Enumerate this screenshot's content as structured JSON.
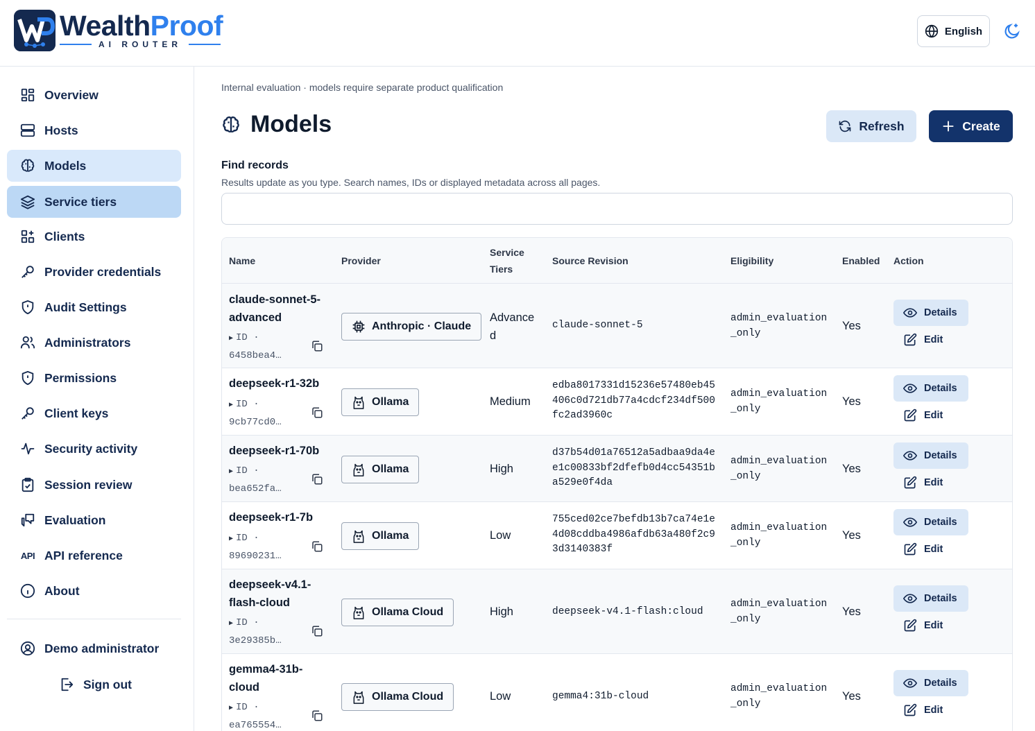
{
  "brand": {
    "word_a": "Wealth",
    "word_b": "Proof",
    "subtitle": "AI ROUTER"
  },
  "header": {
    "language": "English"
  },
  "sidebar": {
    "items": [
      {
        "label": "Overview",
        "icon": "grid-icon"
      },
      {
        "label": "Hosts",
        "icon": "server-icon"
      },
      {
        "label": "Models",
        "icon": "brain-icon"
      },
      {
        "label": "Service tiers",
        "icon": "layers-icon"
      },
      {
        "label": "Clients",
        "icon": "grid-plus-icon"
      },
      {
        "label": "Provider credentials",
        "icon": "key-icon"
      },
      {
        "label": "Audit Settings",
        "icon": "shield-icon"
      },
      {
        "label": "Administrators",
        "icon": "users-icon"
      },
      {
        "label": "Permissions",
        "icon": "shield-icon"
      },
      {
        "label": "Client keys",
        "icon": "key-icon"
      },
      {
        "label": "Security activity",
        "icon": "activity-icon"
      },
      {
        "label": "Session review",
        "icon": "clipboard-icon"
      },
      {
        "label": "Evaluation",
        "icon": "chat-icon"
      },
      {
        "label": "API reference",
        "icon": "api-icon",
        "glyph": "API"
      },
      {
        "label": "About",
        "icon": "info-icon"
      }
    ],
    "user": "Demo administrator",
    "sign_out": "Sign out"
  },
  "main": {
    "notice": "Internal evaluation · models require separate product qualification",
    "title": "Models",
    "refresh_label": "Refresh",
    "create_label": "Create",
    "find_title": "Find records",
    "find_help": "Results update as you type. Search names, IDs or displayed metadata across all pages.",
    "search_value": ""
  },
  "table": {
    "headers": {
      "name": "Name",
      "provider": "Provider",
      "tiers_line1": "Service",
      "tiers_line2": "Tiers",
      "revision": "Source Revision",
      "eligibility": "Eligibility",
      "enabled": "Enabled",
      "action": "Action"
    },
    "id_label": "ID ·",
    "details_label": "Details",
    "edit_label": "Edit",
    "rows": [
      {
        "name_1": "claude-sonnet-5-",
        "name_2": "advanced",
        "id": "6458bea4…",
        "provider": "Anthropic · Claude",
        "provider_icon": "chip-icon",
        "tier_1": "Advance",
        "tier_2": "d",
        "revision": "claude-sonnet-5",
        "eligibility": "admin_evaluation_only",
        "enabled": "Yes"
      },
      {
        "name_1": "deepseek-r1-32b",
        "name_2": "",
        "id": "9cb77cd0…",
        "provider": "Ollama",
        "provider_icon": "llama-icon",
        "tier_1": "Medium",
        "tier_2": "",
        "revision": "edba8017331d15236e57480eb45406c0d721db77a4cdcf234df500fc2ad3960c",
        "eligibility": "admin_evaluation_only",
        "enabled": "Yes"
      },
      {
        "name_1": "deepseek-r1-70b",
        "name_2": "",
        "id": "bea652fa…",
        "provider": "Ollama",
        "provider_icon": "llama-icon",
        "tier_1": "High",
        "tier_2": "",
        "revision": "d37b54d01a76512a5adbaa9da4ee1c00833bf2dfefb0d4cc54351ba529e0f4da",
        "eligibility": "admin_evaluation_only",
        "enabled": "Yes"
      },
      {
        "name_1": "deepseek-r1-7b",
        "name_2": "",
        "id": "89690231…",
        "provider": "Ollama",
        "provider_icon": "llama-icon",
        "tier_1": "Low",
        "tier_2": "",
        "revision": "755ced02ce7befdb13b7ca74e1e4d08cddba4986afdb63a480f2c93d3140383f",
        "eligibility": "admin_evaluation_only",
        "enabled": "Yes"
      },
      {
        "name_1": "deepseek-v4.1-",
        "name_2": "flash-cloud",
        "id": "3e29385b…",
        "provider": "Ollama Cloud",
        "provider_icon": "llama-icon",
        "tier_1": "High",
        "tier_2": "",
        "revision": "deepseek-v4.1-flash:cloud",
        "eligibility": "admin_evaluation_only",
        "enabled": "Yes"
      },
      {
        "name_1": "gemma4-31b-",
        "name_2": "cloud",
        "id": "ea765554…",
        "provider": "Ollama Cloud",
        "provider_icon": "llama-icon",
        "tier_1": "Low",
        "tier_2": "",
        "revision": "gemma4:31b-cloud",
        "eligibility": "admin_evaluation_only",
        "enabled": "Yes"
      }
    ]
  },
  "colors": {
    "navy": "#14294f",
    "brand_blue": "#2f80ed",
    "active_nav": "#d9e9fb",
    "active_nav_strong": "#bcd8f5",
    "primary_button": "#13336b",
    "secondary_button": "#dbe8f7"
  }
}
